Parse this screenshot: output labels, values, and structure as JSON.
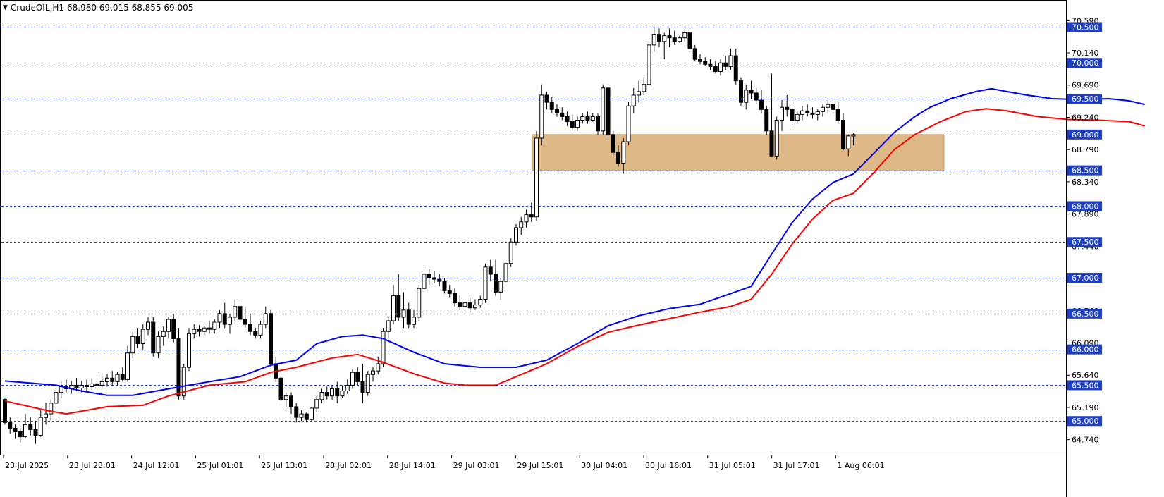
{
  "header": {
    "symbol": "CrudeOIL,H1",
    "ohlc": "68.980 69.015 68.855 69.005"
  },
  "colors": {
    "background": "#ffffff",
    "grid": "#1f3fbf",
    "bull_body": "#ffffff",
    "bear_body": "#000000",
    "ema_fast": "#0000ff",
    "ema_slow": "#ff0000",
    "zone": "#deb887",
    "label_highlight": "#1f3fbf"
  },
  "chart_data": {
    "type": "candlestick",
    "symbol": "CrudeOIL",
    "timeframe": "H1",
    "ylim": [
      64.53,
      70.78
    ],
    "y_tick_labels": [
      "70.590",
      "70.140",
      "69.690",
      "69.240",
      "68.790",
      "68.340",
      "67.890",
      "67.440",
      "66.990",
      "66.540",
      "66.090",
      "65.640",
      "65.190",
      "64.740"
    ],
    "levels": [
      "70.500",
      "70.000",
      "69.500",
      "69.000",
      "68.500",
      "68.000",
      "67.500",
      "67.000",
      "66.500",
      "66.000",
      "65.500",
      "65.000"
    ],
    "x_tick_labels": [
      "23 Jul 2025",
      "23 Jul 23:01",
      "24 Jul 12:01",
      "25 Jul 01:01",
      "25 Jul 13:01",
      "28 Jul 02:01",
      "28 Jul 14:01",
      "29 Jul 03:01",
      "29 Jul 15:01",
      "30 Jul 04:01",
      "30 Jul 16:01",
      "31 Jul 05:01",
      "31 Jul 17:01",
      "1 Aug 06:01"
    ],
    "support_zone": [
      68.5,
      69.0
    ],
    "ema_fast_points": [
      [
        0,
        65.56
      ],
      [
        10,
        65.5
      ],
      [
        15,
        65.42
      ],
      [
        20,
        65.36
      ],
      [
        25,
        65.36
      ],
      [
        32,
        65.45
      ],
      [
        40,
        65.55
      ],
      [
        46,
        65.62
      ],
      [
        52,
        65.78
      ],
      [
        57,
        65.85
      ],
      [
        61,
        66.08
      ],
      [
        66,
        66.18
      ],
      [
        70,
        66.2
      ],
      [
        74,
        66.15
      ],
      [
        80,
        65.96
      ],
      [
        86,
        65.8
      ],
      [
        93,
        65.75
      ],
      [
        100,
        65.75
      ],
      [
        106,
        65.85
      ],
      [
        112,
        66.08
      ],
      [
        118,
        66.33
      ],
      [
        124,
        66.47
      ],
      [
        130,
        66.57
      ],
      [
        136,
        66.63
      ],
      [
        142,
        66.78
      ],
      [
        146,
        66.88
      ],
      [
        150,
        67.33
      ],
      [
        154,
        67.77
      ],
      [
        158,
        68.1
      ],
      [
        162,
        68.33
      ],
      [
        166,
        68.45
      ],
      [
        170,
        68.74
      ],
      [
        174,
        69.03
      ],
      [
        178,
        69.25
      ],
      [
        181,
        69.38
      ],
      [
        185,
        69.5
      ],
      [
        190,
        69.6
      ],
      [
        193,
        69.64
      ],
      [
        196,
        69.6
      ],
      [
        200,
        69.55
      ],
      [
        205,
        69.5
      ],
      [
        210,
        69.49
      ],
      [
        216,
        69.5
      ],
      [
        220,
        69.47
      ],
      [
        223,
        69.42
      ]
    ],
    "ema_slow_points": [
      [
        0,
        65.28
      ],
      [
        8,
        65.15
      ],
      [
        12,
        65.1
      ],
      [
        20,
        65.2
      ],
      [
        27,
        65.22
      ],
      [
        32,
        65.35
      ],
      [
        40,
        65.5
      ],
      [
        47,
        65.55
      ],
      [
        52,
        65.68
      ],
      [
        57,
        65.75
      ],
      [
        64,
        65.88
      ],
      [
        69,
        65.93
      ],
      [
        74,
        65.82
      ],
      [
        80,
        65.66
      ],
      [
        86,
        65.53
      ],
      [
        90,
        65.5
      ],
      [
        96,
        65.5
      ],
      [
        100,
        65.62
      ],
      [
        106,
        65.8
      ],
      [
        112,
        66.04
      ],
      [
        118,
        66.24
      ],
      [
        124,
        66.34
      ],
      [
        130,
        66.43
      ],
      [
        136,
        66.52
      ],
      [
        142,
        66.6
      ],
      [
        146,
        66.7
      ],
      [
        150,
        67.05
      ],
      [
        154,
        67.47
      ],
      [
        158,
        67.82
      ],
      [
        162,
        68.08
      ],
      [
        166,
        68.18
      ],
      [
        170,
        68.47
      ],
      [
        174,
        68.79
      ],
      [
        178,
        69.0
      ],
      [
        183,
        69.18
      ],
      [
        188,
        69.32
      ],
      [
        192,
        69.36
      ],
      [
        196,
        69.33
      ],
      [
        202,
        69.25
      ],
      [
        208,
        69.21
      ],
      [
        214,
        69.2
      ],
      [
        220,
        69.18
      ],
      [
        223,
        69.12
      ]
    ],
    "candles": [
      [
        0,
        65.3,
        65.33,
        64.95,
        64.98
      ],
      [
        1,
        64.98,
        65.05,
        64.82,
        64.9
      ],
      [
        2,
        64.9,
        64.95,
        64.75,
        64.85
      ],
      [
        3,
        64.85,
        64.9,
        64.7,
        64.78
      ],
      [
        4,
        64.78,
        65.1,
        64.76,
        64.95
      ],
      [
        5,
        64.95,
        65.05,
        64.8,
        64.88
      ],
      [
        6,
        64.88,
        65.0,
        64.68,
        64.8
      ],
      [
        7,
        64.8,
        65.15,
        64.78,
        65.05
      ],
      [
        8,
        65.05,
        65.25,
        64.95,
        65.1
      ],
      [
        9,
        65.1,
        65.3,
        65.0,
        65.25
      ],
      [
        10,
        65.25,
        65.45,
        65.2,
        65.4
      ],
      [
        11,
        65.4,
        65.55,
        65.32,
        65.48
      ],
      [
        12,
        65.48,
        65.58,
        65.4,
        65.45
      ],
      [
        13,
        65.45,
        65.56,
        65.38,
        65.5
      ],
      [
        14,
        65.5,
        65.6,
        65.42,
        65.46
      ],
      [
        15,
        65.46,
        65.56,
        65.4,
        65.5
      ],
      [
        16,
        65.5,
        65.58,
        65.42,
        65.48
      ],
      [
        17,
        65.48,
        65.6,
        65.44,
        65.52
      ],
      [
        18,
        65.52,
        65.62,
        65.44,
        65.5
      ],
      [
        19,
        65.5,
        65.62,
        65.45,
        65.55
      ],
      [
        20,
        65.55,
        65.66,
        65.48,
        65.6
      ],
      [
        21,
        65.6,
        65.7,
        65.5,
        65.55
      ],
      [
        22,
        65.55,
        65.68,
        65.5,
        65.65
      ],
      [
        23,
        65.65,
        65.75,
        65.55,
        65.58
      ],
      [
        24,
        65.58,
        66.05,
        65.55,
        65.95
      ],
      [
        25,
        65.95,
        66.25,
        65.88,
        66.18
      ],
      [
        26,
        66.18,
        66.3,
        66.02,
        66.08
      ],
      [
        27,
        66.08,
        66.35,
        66.0,
        66.28
      ],
      [
        28,
        66.28,
        66.45,
        66.2,
        66.38
      ],
      [
        29,
        66.38,
        66.45,
        65.9,
        65.95
      ],
      [
        30,
        65.95,
        66.25,
        65.88,
        66.18
      ],
      [
        31,
        66.18,
        66.32,
        66.05,
        66.25
      ],
      [
        32,
        66.25,
        66.45,
        66.15,
        66.42
      ],
      [
        33,
        66.42,
        66.5,
        66.1,
        66.15
      ],
      [
        34,
        66.15,
        66.3,
        65.3,
        65.35
      ],
      [
        35,
        65.35,
        65.8,
        65.3,
        65.75
      ],
      [
        36,
        65.75,
        66.3,
        65.7,
        66.22
      ],
      [
        37,
        66.22,
        66.35,
        66.15,
        66.28
      ],
      [
        38,
        66.28,
        66.34,
        66.18,
        66.25
      ],
      [
        39,
        66.25,
        66.32,
        66.2,
        66.3
      ],
      [
        40,
        66.3,
        66.4,
        66.22,
        66.28
      ],
      [
        41,
        66.28,
        66.42,
        66.22,
        66.38
      ],
      [
        42,
        66.38,
        66.55,
        66.3,
        66.5
      ],
      [
        43,
        66.5,
        66.65,
        66.3,
        66.35
      ],
      [
        44,
        66.35,
        66.5,
        66.22,
        66.45
      ],
      [
        45,
        66.45,
        66.7,
        66.4,
        66.6
      ],
      [
        46,
        66.6,
        66.65,
        66.38,
        66.42
      ],
      [
        47,
        66.42,
        66.6,
        66.3,
        66.35
      ],
      [
        48,
        66.35,
        66.5,
        66.2,
        66.25
      ],
      [
        49,
        66.25,
        66.3,
        66.15,
        66.2
      ],
      [
        50,
        66.2,
        66.4,
        66.15,
        66.35
      ],
      [
        51,
        66.35,
        66.6,
        66.3,
        66.5
      ],
      [
        52,
        66.5,
        66.55,
        65.75,
        65.8
      ],
      [
        53,
        65.8,
        65.9,
        65.55,
        65.6
      ],
      [
        54,
        65.6,
        65.65,
        65.25,
        65.3
      ],
      [
        55,
        65.3,
        65.4,
        65.2,
        65.35
      ],
      [
        56,
        65.35,
        65.4,
        65.1,
        65.2
      ],
      [
        57,
        65.2,
        65.25,
        64.98,
        65.05
      ],
      [
        58,
        65.05,
        65.15,
        65.0,
        65.1
      ],
      [
        59,
        65.1,
        65.12,
        64.98,
        65.02
      ],
      [
        60,
        65.02,
        65.2,
        65.0,
        65.18
      ],
      [
        61,
        65.18,
        65.35,
        65.12,
        65.3
      ],
      [
        62,
        65.3,
        65.45,
        65.25,
        65.4
      ],
      [
        63,
        65.4,
        65.48,
        65.3,
        65.35
      ],
      [
        64,
        65.35,
        65.5,
        65.3,
        65.45
      ],
      [
        65,
        65.45,
        65.55,
        65.25,
        65.35
      ],
      [
        66,
        65.35,
        65.5,
        65.32,
        65.42
      ],
      [
        67,
        65.42,
        65.58,
        65.38,
        65.5
      ],
      [
        68,
        65.5,
        65.72,
        65.45,
        65.68
      ],
      [
        69,
        65.68,
        65.75,
        65.5,
        65.55
      ],
      [
        70,
        65.55,
        65.8,
        65.25,
        65.4
      ],
      [
        71,
        65.4,
        65.7,
        65.35,
        65.65
      ],
      [
        72,
        65.65,
        65.75,
        65.55,
        65.7
      ],
      [
        73,
        65.7,
        65.9,
        65.65,
        65.8
      ],
      [
        74,
        65.8,
        66.3,
        65.75,
        66.25
      ],
      [
        75,
        66.25,
        66.45,
        66.15,
        66.4
      ],
      [
        76,
        66.4,
        66.9,
        66.35,
        66.75
      ],
      [
        77,
        66.75,
        67.05,
        66.4,
        66.45
      ],
      [
        78,
        66.45,
        66.8,
        66.3,
        66.55
      ],
      [
        79,
        66.55,
        66.65,
        66.3,
        66.35
      ],
      [
        80,
        66.35,
        66.55,
        66.3,
        66.45
      ],
      [
        81,
        66.45,
        66.9,
        66.4,
        66.85
      ],
      [
        82,
        66.85,
        67.15,
        66.8,
        67.05
      ],
      [
        83,
        67.05,
        67.12,
        66.9,
        67.0
      ],
      [
        84,
        67.0,
        67.1,
        66.92,
        66.98
      ],
      [
        85,
        66.98,
        67.05,
        66.88,
        66.95
      ],
      [
        86,
        66.95,
        67.0,
        66.78,
        66.82
      ],
      [
        87,
        66.82,
        66.9,
        66.72,
        66.78
      ],
      [
        88,
        66.78,
        66.85,
        66.6,
        66.65
      ],
      [
        89,
        66.65,
        66.75,
        66.55,
        66.6
      ],
      [
        90,
        66.6,
        66.7,
        66.55,
        66.65
      ],
      [
        91,
        66.65,
        66.72,
        66.52,
        66.58
      ],
      [
        92,
        66.58,
        66.7,
        66.55,
        66.62
      ],
      [
        93,
        66.62,
        66.75,
        66.58,
        66.7
      ],
      [
        94,
        66.7,
        67.2,
        66.65,
        67.15
      ],
      [
        95,
        67.15,
        67.25,
        66.95,
        67.05
      ],
      [
        96,
        67.05,
        67.25,
        66.75,
        66.8
      ],
      [
        97,
        66.8,
        67.0,
        66.7,
        66.95
      ],
      [
        98,
        66.95,
        67.25,
        66.9,
        67.2
      ],
      [
        99,
        67.2,
        67.55,
        67.15,
        67.5
      ],
      [
        100,
        67.5,
        67.75,
        67.45,
        67.7
      ],
      [
        101,
        67.7,
        67.85,
        67.6,
        67.78
      ],
      [
        102,
        67.78,
        67.95,
        67.7,
        67.88
      ],
      [
        103,
        67.88,
        68.05,
        67.78,
        67.85
      ],
      [
        104,
        67.85,
        69.05,
        67.8,
        68.95
      ],
      [
        105,
        68.95,
        69.7,
        68.85,
        69.55
      ],
      [
        106,
        69.55,
        69.6,
        69.35,
        69.45
      ],
      [
        107,
        69.45,
        69.52,
        69.3,
        69.35
      ],
      [
        108,
        69.35,
        69.42,
        69.25,
        69.3
      ],
      [
        109,
        69.3,
        69.38,
        69.2,
        69.25
      ],
      [
        110,
        69.25,
        69.32,
        69.12,
        69.18
      ],
      [
        111,
        69.18,
        69.28,
        69.05,
        69.1
      ],
      [
        112,
        69.1,
        69.25,
        69.05,
        69.2
      ],
      [
        113,
        69.2,
        69.3,
        69.15,
        69.25
      ],
      [
        114,
        69.25,
        69.32,
        69.15,
        69.2
      ],
      [
        115,
        69.2,
        69.3,
        69.18,
        69.25
      ],
      [
        116,
        69.25,
        69.3,
        69.0,
        69.05
      ],
      [
        117,
        69.05,
        69.7,
        69.0,
        69.65
      ],
      [
        118,
        69.65,
        69.7,
        68.95,
        69.0
      ],
      [
        119,
        69.0,
        69.05,
        68.7,
        68.75
      ],
      [
        120,
        68.75,
        68.85,
        68.55,
        68.6
      ],
      [
        121,
        68.6,
        68.95,
        68.45,
        68.9
      ],
      [
        122,
        68.9,
        69.45,
        68.85,
        69.4
      ],
      [
        123,
        69.4,
        69.65,
        69.3,
        69.55
      ],
      [
        124,
        69.55,
        69.75,
        69.45,
        69.6
      ],
      [
        125,
        69.6,
        69.8,
        69.55,
        69.7
      ],
      [
        126,
        69.7,
        70.35,
        69.65,
        70.25
      ],
      [
        127,
        70.25,
        70.5,
        70.15,
        70.4
      ],
      [
        128,
        70.4,
        70.48,
        70.22,
        70.3
      ],
      [
        129,
        70.3,
        70.42,
        70.05,
        70.38
      ],
      [
        130,
        70.38,
        70.48,
        70.22,
        70.35
      ],
      [
        131,
        70.35,
        70.45,
        70.25,
        70.3
      ],
      [
        132,
        70.3,
        70.38,
        70.28,
        70.35
      ],
      [
        133,
        70.35,
        70.45,
        70.3,
        70.42
      ],
      [
        134,
        70.42,
        70.46,
        70.15,
        70.2
      ],
      [
        135,
        70.2,
        70.25,
        70.02,
        70.05
      ],
      [
        136,
        70.05,
        70.12,
        69.98,
        70.02
      ],
      [
        137,
        70.02,
        70.08,
        69.95,
        69.98
      ],
      [
        138,
        69.98,
        70.05,
        69.9,
        69.95
      ],
      [
        139,
        69.95,
        70.02,
        69.85,
        69.88
      ],
      [
        140,
        69.88,
        70.05,
        69.82,
        70.0
      ],
      [
        141,
        70.0,
        70.1,
        69.9,
        69.95
      ],
      [
        142,
        69.95,
        70.2,
        69.9,
        70.1
      ],
      [
        143,
        70.1,
        70.2,
        69.7,
        69.75
      ],
      [
        144,
        69.75,
        69.8,
        69.4,
        69.45
      ],
      [
        145,
        69.45,
        69.7,
        69.35,
        69.62
      ],
      [
        146,
        69.62,
        69.75,
        69.5,
        69.58
      ],
      [
        147,
        69.58,
        69.65,
        69.42,
        69.48
      ],
      [
        148,
        69.48,
        69.62,
        69.3,
        69.35
      ],
      [
        149,
        69.35,
        69.4,
        69.0,
        69.05
      ],
      [
        150,
        69.05,
        69.85,
        68.75,
        68.7
      ],
      [
        151,
        68.7,
        69.25,
        68.65,
        69.2
      ],
      [
        152,
        69.2,
        69.48,
        69.05,
        69.38
      ],
      [
        153,
        69.38,
        69.55,
        69.25,
        69.35
      ],
      [
        154,
        69.35,
        69.45,
        69.1,
        69.2
      ],
      [
        155,
        69.2,
        69.32,
        69.15,
        69.28
      ],
      [
        156,
        69.28,
        69.4,
        69.2,
        69.33
      ],
      [
        157,
        69.33,
        69.42,
        69.25,
        69.3
      ],
      [
        158,
        69.3,
        69.38,
        69.22,
        69.28
      ],
      [
        159,
        69.28,
        69.35,
        69.2,
        69.32
      ],
      [
        160,
        69.32,
        69.42,
        69.25,
        69.38
      ],
      [
        161,
        69.38,
        69.48,
        69.3,
        69.42
      ],
      [
        162,
        69.42,
        69.5,
        69.3,
        69.35
      ],
      [
        163,
        69.35,
        69.45,
        69.15,
        69.2
      ],
      [
        164,
        69.2,
        69.3,
        68.78,
        68.8
      ],
      [
        165,
        68.8,
        69.0,
        68.7,
        68.98
      ],
      [
        166,
        68.98,
        69.02,
        68.85,
        69.0
      ]
    ]
  }
}
